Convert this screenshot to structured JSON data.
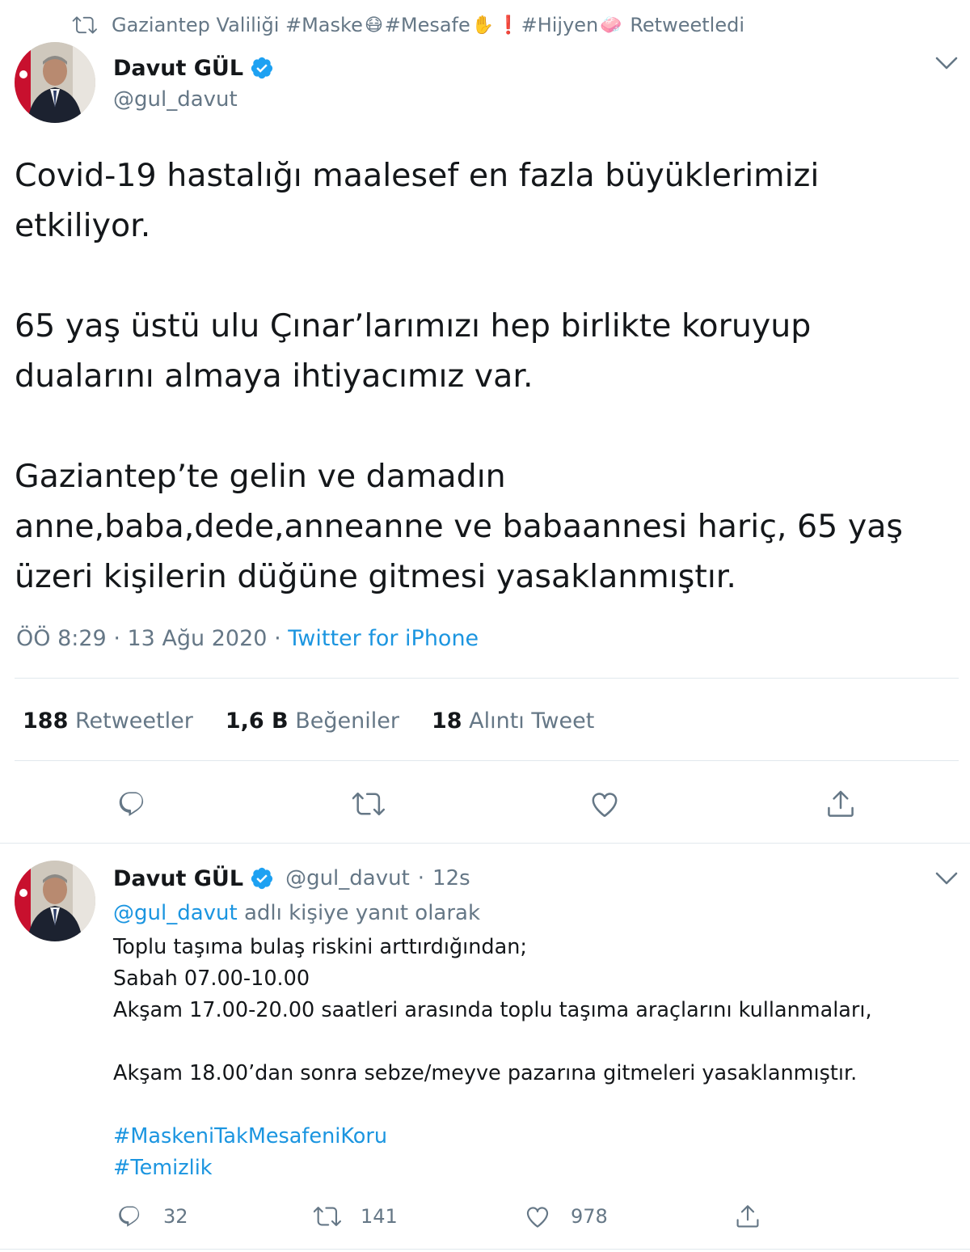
{
  "retweet_header": {
    "account": "Gaziantep Valiliği #Maske",
    "tag_mesafe": "#Mesafe",
    "tag_hijyen": "#Hijyen",
    "label": "Retweetledi",
    "emoji_mask": "😷",
    "emoji_hand": "✋",
    "emoji_exclaim": "❗",
    "emoji_soap": "🧼"
  },
  "main_tweet": {
    "author_name": "Davut GÜL",
    "author_handle": "@gul_davut",
    "lines": [
      "Covid-19 hastalığı maalesef en fazla büyüklerimizi",
      "etkiliyor.",
      "",
      "65 yaş üstü ulu Çınar’larımızı hep birlikte koruyup",
      "dualarını almaya ihtiyacımız var.",
      "",
      "Gaziantep’te gelin ve damadın",
      "anne,baba,dede,anneanne ve babaannesi hariç, 65 yaş",
      "üzeri kişilerin düğüne gitmesi yasaklanmıştır."
    ],
    "time": "ÖÖ 8:29",
    "date": "13 Ağu 2020",
    "separator": "·",
    "source": "Twitter for iPhone",
    "stats": {
      "retweets_count": "188",
      "retweets_label": "Retweetler",
      "likes_count": "1,6 B",
      "likes_label": "Beğeniler",
      "quotes_count": "18",
      "quotes_label": "Alıntı Tweet"
    }
  },
  "reply_tweet": {
    "author_name": "Davut GÜL",
    "author_handle": "@gul_davut",
    "separator": "·",
    "age": "12s",
    "reply_to_handle": "@gul_davut",
    "reply_to_label": "adlı kişiye yanıt olarak",
    "lines": [
      "Toplu taşıma bulaş riskini arttırdığından;",
      "Sabah 07.00-10.00",
      "Akşam 17.00-20.00 saatleri arasında toplu taşıma araçlarını kullanmaları,",
      "",
      "Akşam 18.00’dan sonra sebze/meyve pazarına gitmeleri yasaklanmıştır.",
      ""
    ],
    "hashtags": [
      "#MaskeniTakMesafeniKoru",
      "#Temizlik"
    ],
    "actions": {
      "replies": "32",
      "retweets": "141",
      "likes": "978"
    }
  },
  "colors": {
    "text": "#14171a",
    "secondary": "#657786",
    "link": "#1b95e0",
    "divider": "#e1e8ed",
    "verified": "#1da1f2"
  }
}
